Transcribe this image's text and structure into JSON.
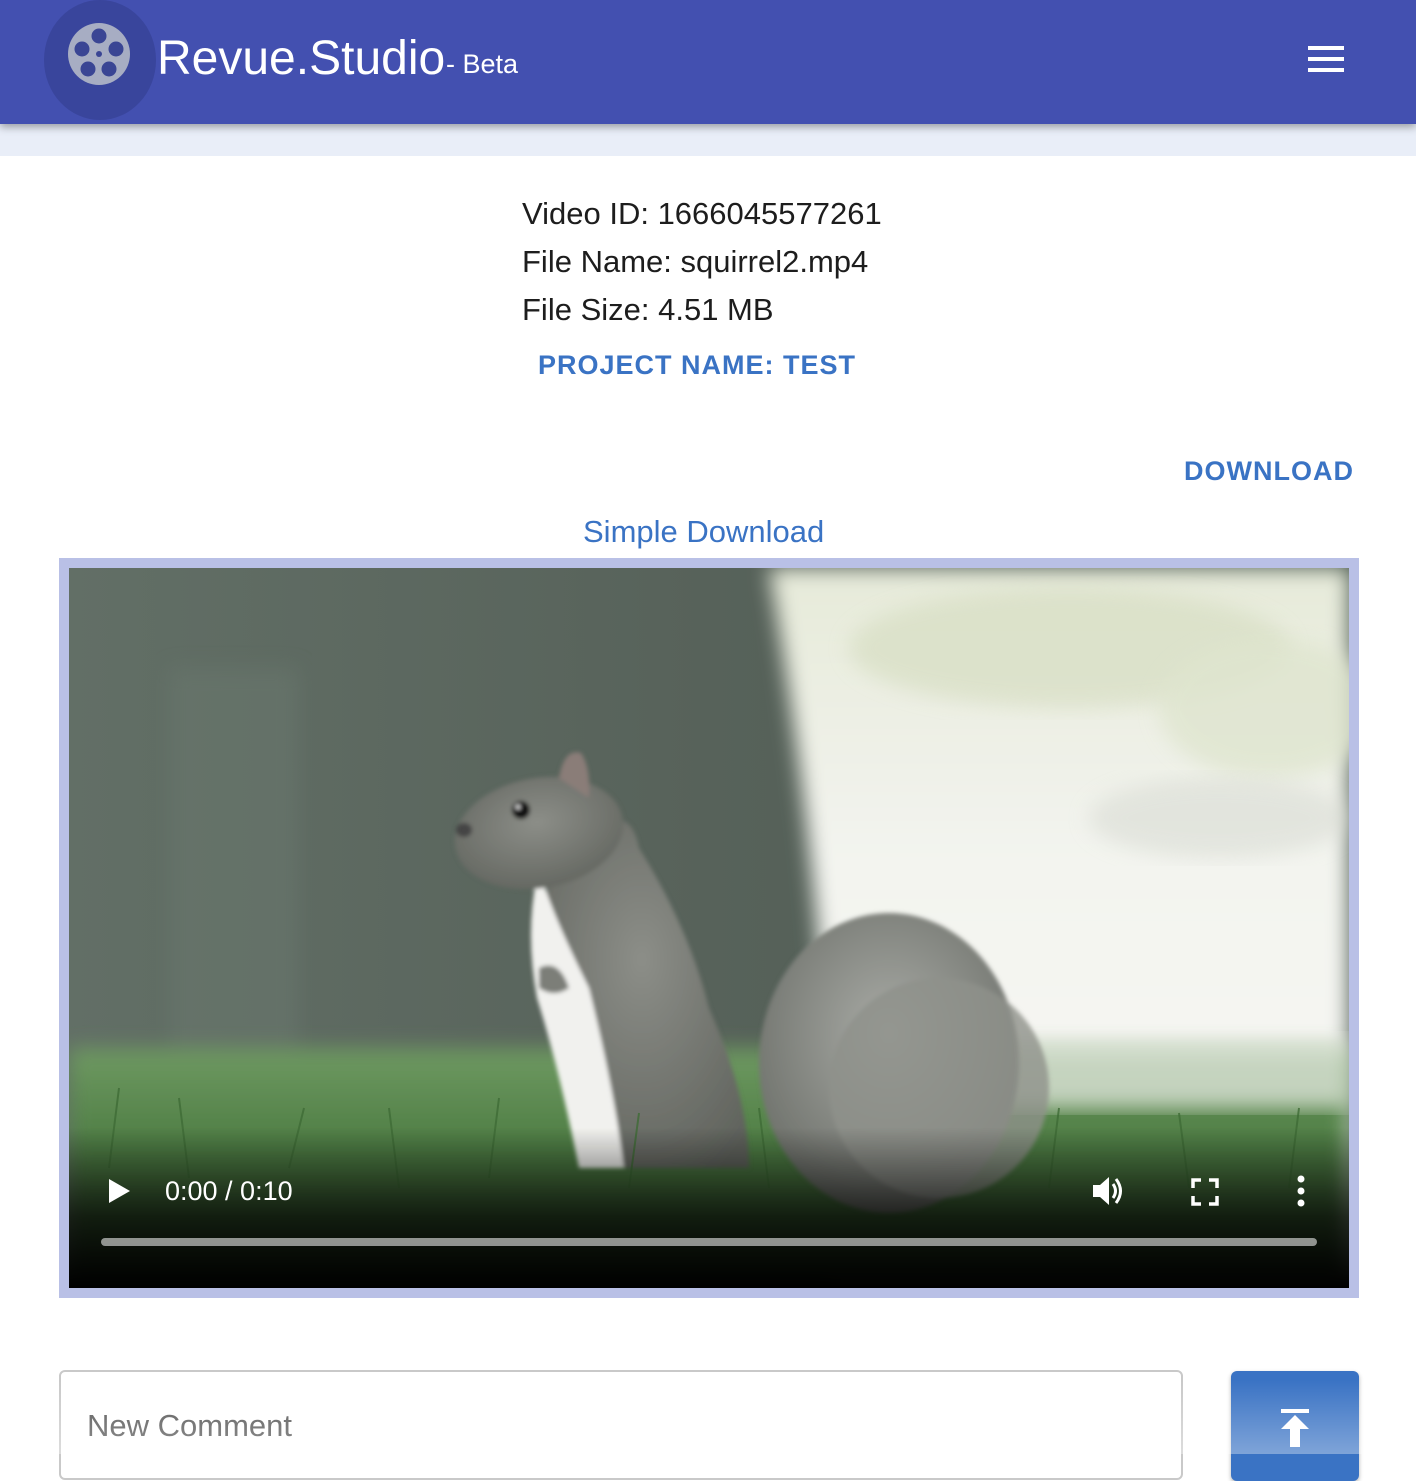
{
  "app": {
    "name": "Revue.Studio",
    "badge": "- Beta",
    "logo_icon": "film-reel-icon",
    "menu_icon": "hamburger-menu-icon"
  },
  "video_info": {
    "id_line": "Video ID: 1666045577261",
    "filename_line": "File Name: squirrel2.mp4",
    "filesize_line": "File Size: 4.51 MB"
  },
  "project_link": "PROJECT NAME: TEST",
  "download_label": "DOWNLOAD",
  "simple_download_label": "Simple Download",
  "player": {
    "time": "0:00 / 0:10",
    "progress": 0,
    "icons": [
      "play-icon",
      "volume-icon",
      "fullscreen-icon",
      "more-options-icon"
    ]
  },
  "comment": {
    "placeholder": "New Comment",
    "value": "",
    "submit_icon": "upload-icon"
  },
  "colors": {
    "appbar": "#4350b0",
    "accent": "#3a73c4",
    "video_border": "#b9c0e6"
  }
}
